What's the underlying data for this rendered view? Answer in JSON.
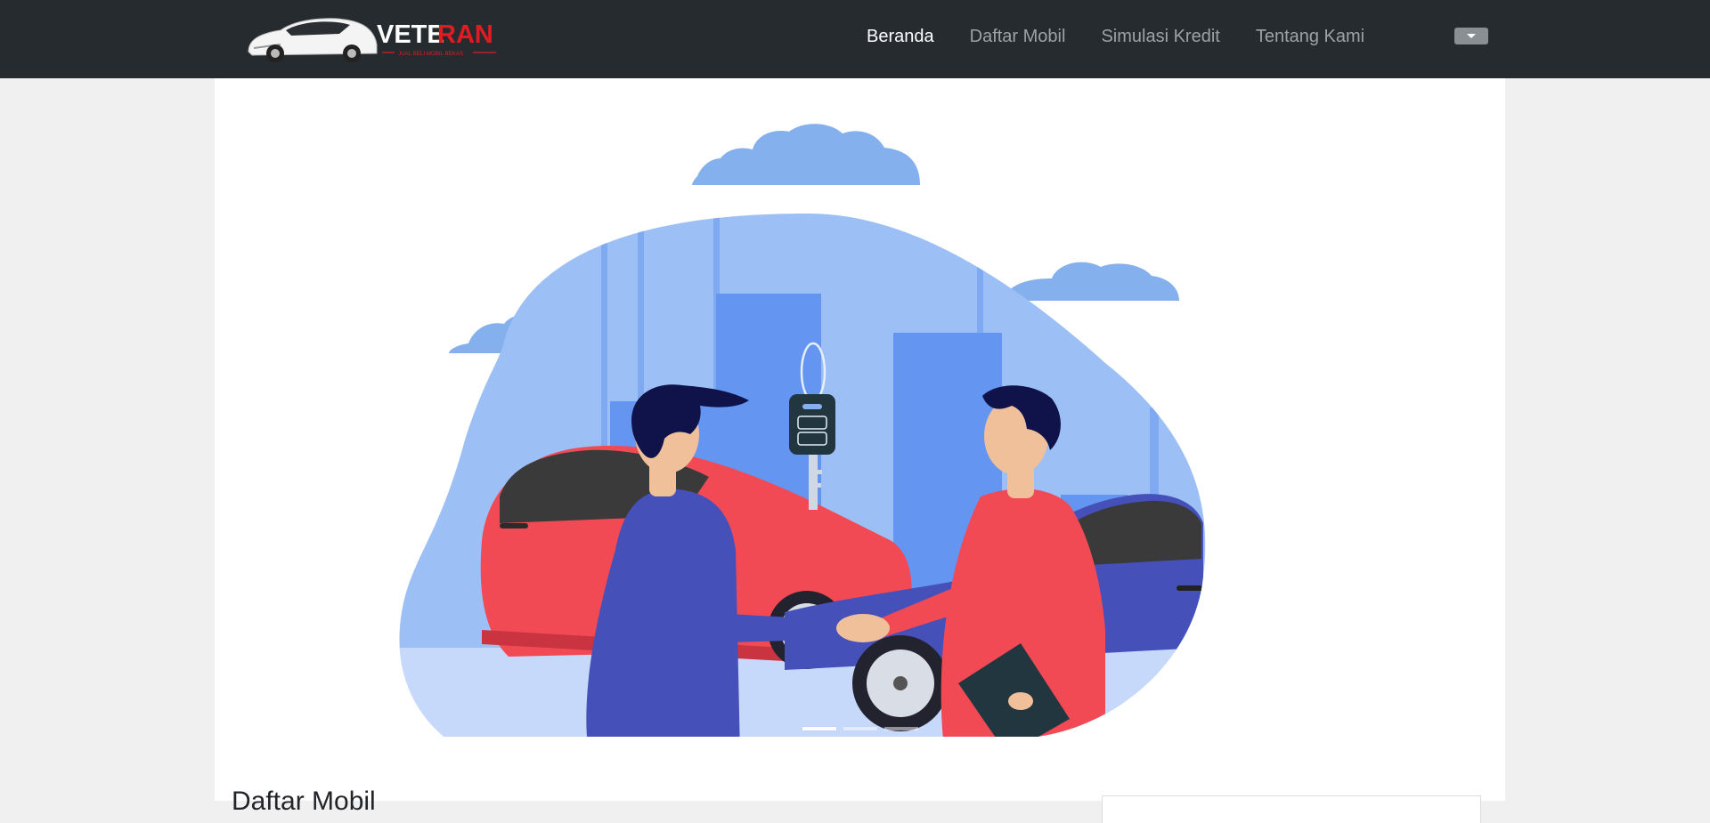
{
  "brand": {
    "name": "VETERAN",
    "name_part1": "VETE",
    "name_part2": "RAN",
    "tagline": "JUAL BELI MOBIL BEKAS",
    "logo_icon": "sports-car-icon"
  },
  "nav": {
    "items": [
      {
        "label": "Beranda",
        "active": true
      },
      {
        "label": "Daftar Mobil",
        "active": false
      },
      {
        "label": "Simulasi Kredit",
        "active": false
      },
      {
        "label": "Tentang Kami",
        "active": false
      }
    ],
    "dropdown_icon": "caret-down-icon"
  },
  "carousel": {
    "slide_count": 3,
    "active_index": 0,
    "illustration": "car-sale-handshake-illustration"
  },
  "main": {
    "section_title": "Daftar Mobil"
  },
  "colors": {
    "navbar_bg": "#262b30",
    "page_bg": "#f0f0f0",
    "content_bg": "#ffffff",
    "brand_red": "#e11b22",
    "nav_active": "#ffffff",
    "nav_inactive": "#9da2a6"
  }
}
